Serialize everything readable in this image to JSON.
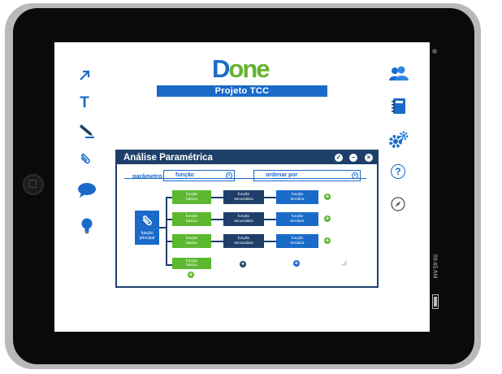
{
  "app": {
    "logo_d": "D",
    "logo_rest": "one",
    "project_title": "Projeto TCC"
  },
  "statusbar": {
    "time": "09:45 AM"
  },
  "left_toolbar": [
    {
      "name": "arrow-tool",
      "icon": "arrow-up-right-icon"
    },
    {
      "name": "text-tool",
      "icon": "text-T-icon",
      "glyph": "T"
    },
    {
      "name": "pen-tool",
      "icon": "pencil-icon"
    },
    {
      "name": "attach-tool",
      "icon": "paperclip-icon"
    },
    {
      "name": "comment-tool",
      "icon": "speech-bubble-icon"
    },
    {
      "name": "idea-tool",
      "icon": "lightbulb-icon"
    }
  ],
  "right_toolbar": [
    {
      "name": "users",
      "icon": "people-icon"
    },
    {
      "name": "notebook",
      "icon": "notebook-icon"
    },
    {
      "name": "settings",
      "icon": "gears-icon"
    },
    {
      "name": "help",
      "icon": "question-icon",
      "glyph": "?"
    },
    {
      "name": "navigate",
      "icon": "compass-icon"
    }
  ],
  "dialog": {
    "title": "Análise Paramétrica",
    "controls": [
      "✓",
      "–",
      "×"
    ],
    "param_label": "parâmetro",
    "param_value": "função",
    "sort_value": "ordenar por",
    "main_box": "função\nprincipal",
    "rows": [
      {
        "basic": "função\nbásica",
        "secondary": "função\nsecundária",
        "tertiary": "função\nterciária"
      },
      {
        "basic": "função\nbásica",
        "secondary": "função\nsecundária",
        "tertiary": "função\nterciária"
      },
      {
        "basic": "função\nbásica",
        "secondary": "função\nsecundária",
        "tertiary": "função\nterciária"
      },
      {
        "basic": "função\nbásica"
      }
    ],
    "plus_glyph": "+"
  },
  "colors": {
    "brand_blue": "#1a6ac9",
    "brand_green": "#5cb82f",
    "navy": "#1e3f6a",
    "bezel": "#0a0a0a"
  }
}
